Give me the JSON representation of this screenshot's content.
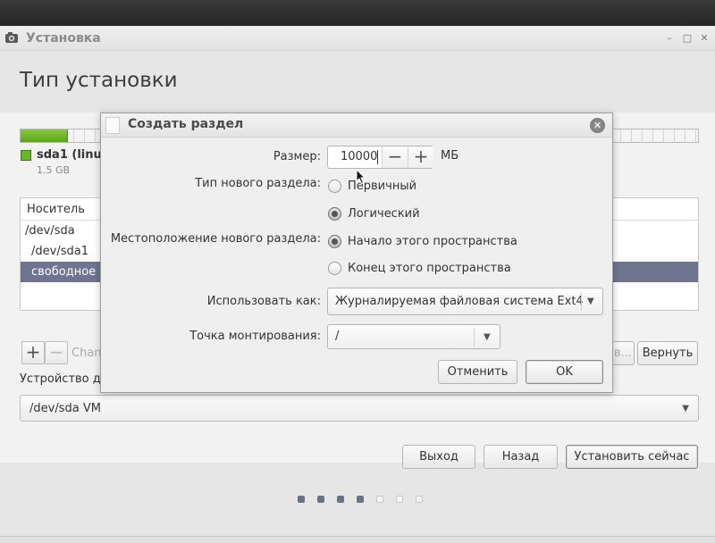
{
  "window": {
    "title": "Установка",
    "minimize": "–",
    "maximize": "□",
    "close": "✕"
  },
  "page_heading": "Тип установки",
  "partition_legend": {
    "name": "sda1 (linu",
    "size": "1.5 GB",
    "used_fraction": 0.07
  },
  "table": {
    "header": "Носитель",
    "rows": [
      "/dev/sda",
      "/dev/sda1",
      "свободное"
    ]
  },
  "toolbar": {
    "add": "+",
    "remove": "−",
    "change_label": "Chan",
    "new_table_label": "в...",
    "revert_label": "Вернуть"
  },
  "boot_device": {
    "label": "Устройство д",
    "value": "/dev/sda  VM"
  },
  "nav_buttons": {
    "quit": "Выход",
    "back": "Назад",
    "install_now": "Установить сейчас"
  },
  "progress_dots": {
    "total": 7,
    "current": 4
  },
  "dialog": {
    "title": "Создать раздел",
    "close": "✕",
    "size_label": "Размер:",
    "size_value": "10000",
    "size_unit": "МБ",
    "decrement": "−",
    "increment": "+",
    "type_label": "Тип нового раздела:",
    "type_primary": "Первичный",
    "type_logical": "Логический",
    "type_selected": "logical",
    "location_label": "Местоположение нового раздела:",
    "location_begin": "Начало этого пространства",
    "location_end": "Конец этого пространства",
    "location_selected": "begin",
    "use_as_label": "Использовать как:",
    "use_as_value": "Журналируемая файловая система Ext4",
    "mount_label": "Точка монтирования:",
    "mount_value": "/",
    "cancel": "Отменить",
    "ok": "OK"
  }
}
